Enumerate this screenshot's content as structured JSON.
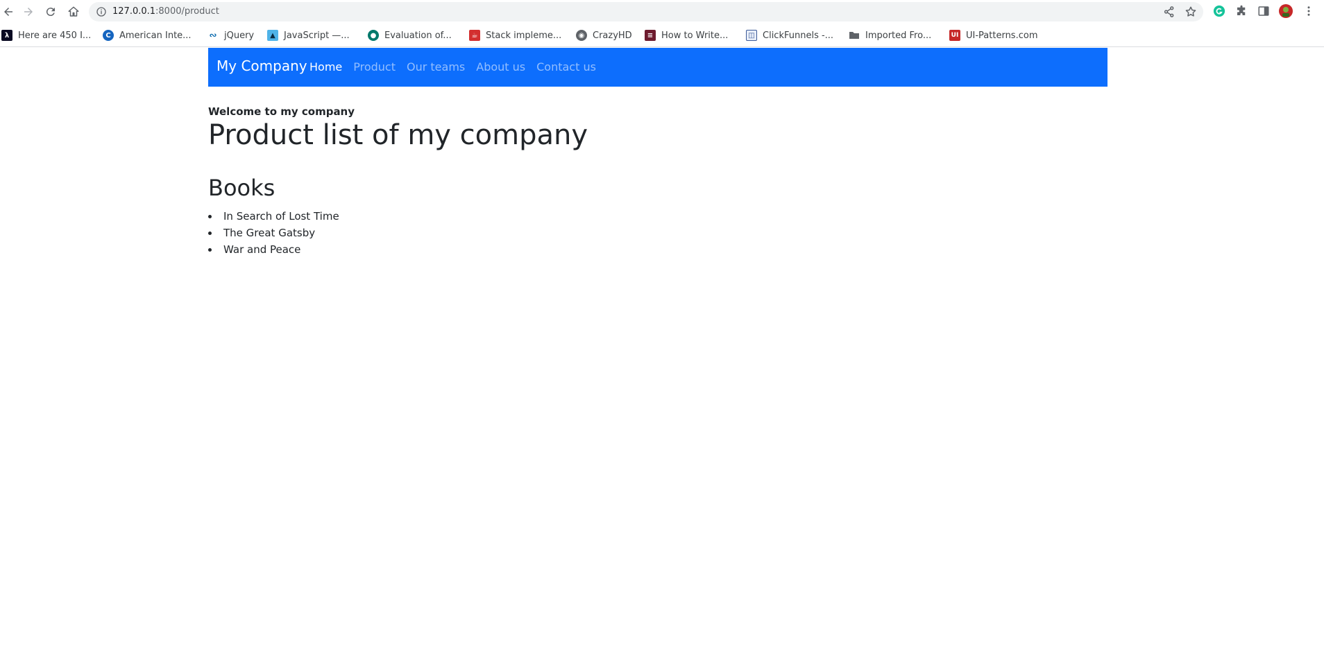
{
  "browser": {
    "url_host": "127.0.0.1",
    "url_path": ":8000/product",
    "bookmarks": [
      {
        "label": "Here are 450 I...",
        "icon": "freecodecamp-icon",
        "color": "#0a0a23"
      },
      {
        "label": "American Inte...",
        "icon": "c-logo-icon",
        "color": "#1565c0"
      },
      {
        "label": "jQuery",
        "icon": "jquery-icon",
        "color": "#0769ad"
      },
      {
        "label": "JavaScript —...",
        "icon": "javascript-site-icon",
        "color": "#1e88c7"
      },
      {
        "label": "Evaluation of...",
        "icon": "evaluation-site-icon",
        "color": "#00796b"
      },
      {
        "label": "Stack impleme...",
        "icon": "stack-site-icon",
        "color": "#d32f2f"
      },
      {
        "label": "CrazyHD",
        "icon": "globe-icon",
        "color": "#5f6368"
      },
      {
        "label": "How to Write...",
        "icon": "how-to-write-icon",
        "color": "#6d1b2e"
      },
      {
        "label": "ClickFunnels -...",
        "icon": "clickfunnels-icon",
        "color": "#3b5998"
      },
      {
        "label": "Imported Fro...",
        "icon": "folder-icon",
        "color": "#5f6368"
      },
      {
        "label": "UI-Patterns.com",
        "icon": "ui-patterns-icon",
        "color": "#c62828"
      }
    ]
  },
  "navbar": {
    "brand": "My Company",
    "links": [
      {
        "label": "Home",
        "active": true
      },
      {
        "label": "Product",
        "active": false
      },
      {
        "label": "Our teams",
        "active": false
      },
      {
        "label": "About us",
        "active": false
      },
      {
        "label": "Contact us",
        "active": false
      }
    ],
    "color": "#0d6efd"
  },
  "content": {
    "welcome": "Welcome to my company",
    "title": "Product list of my company",
    "section": "Books",
    "items": [
      "In Search of Lost Time",
      "The Great Gatsby",
      "War and Peace"
    ]
  }
}
